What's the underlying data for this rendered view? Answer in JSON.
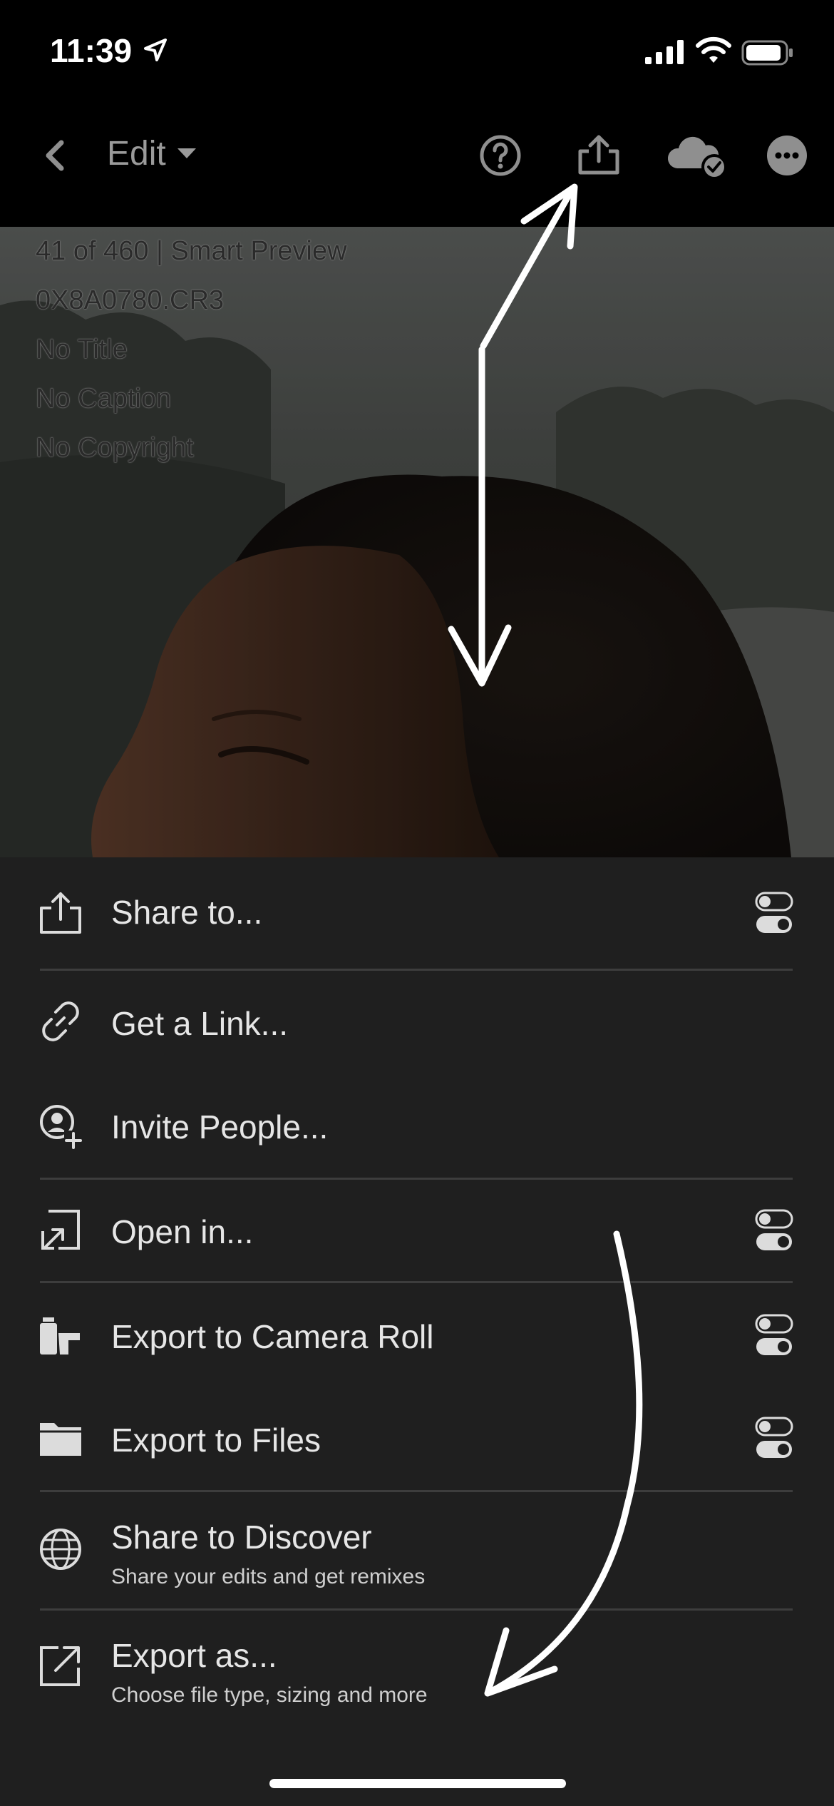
{
  "status_bar": {
    "time": "11:39"
  },
  "topbar": {
    "edit_label": "Edit"
  },
  "photo_info": {
    "lines": [
      "41 of 460 | Smart Preview",
      "0X8A0780.CR3",
      "No Title",
      "No Caption",
      "No Copyright"
    ]
  },
  "menu": {
    "items": [
      {
        "title": "Share to...",
        "subtitle": "",
        "icon": "share-icon",
        "toggle": true
      },
      {
        "title": "Get a Link...",
        "subtitle": "",
        "icon": "link-icon",
        "toggle": false
      },
      {
        "title": "Invite People...",
        "subtitle": "",
        "icon": "invite-person-icon",
        "toggle": false
      },
      {
        "title": "Open in...",
        "subtitle": "",
        "icon": "open-in-icon",
        "toggle": true
      },
      {
        "title": "Export to Camera Roll",
        "subtitle": "",
        "icon": "camera-roll-icon",
        "toggle": true
      },
      {
        "title": "Export to Files",
        "subtitle": "",
        "icon": "folder-icon",
        "toggle": true
      },
      {
        "title": "Share to Discover",
        "subtitle": "Share your edits and get remixes",
        "icon": "globe-icon",
        "toggle": false
      },
      {
        "title": "Export as...",
        "subtitle": "Choose file type, sizing and more",
        "icon": "export-as-icon",
        "toggle": false
      }
    ]
  },
  "colors": {
    "sheet_bg": "#1f1f1f",
    "bar_bg": "#000000",
    "text": "#e6e6e6",
    "muted": "#9a9a9a"
  }
}
